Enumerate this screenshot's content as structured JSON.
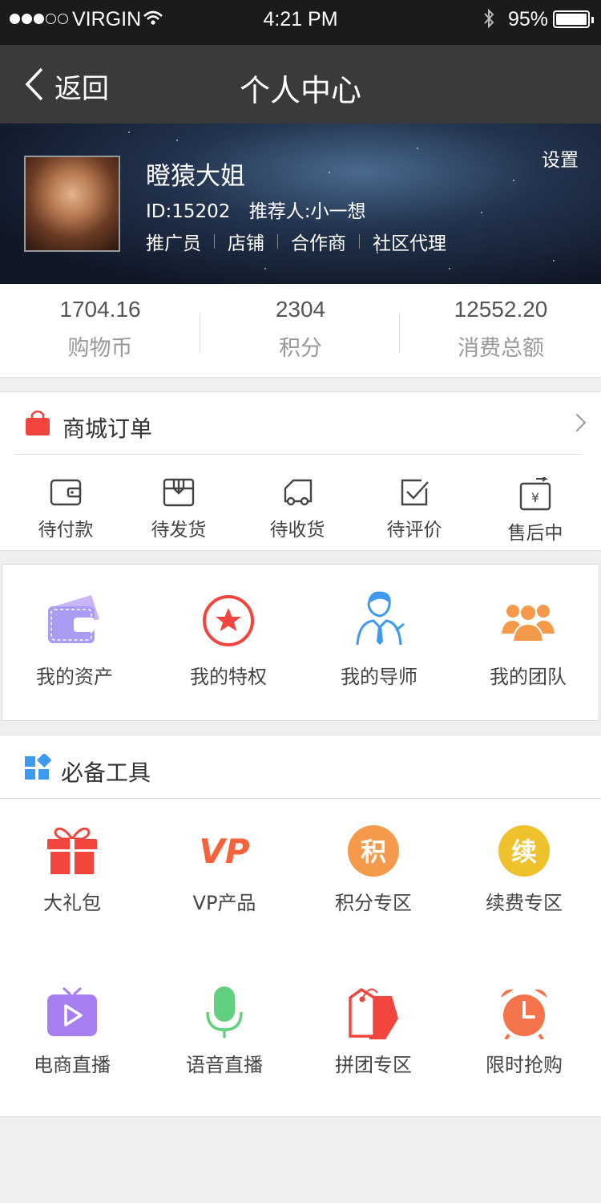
{
  "status_bar": {
    "carrier": "VIRGIN",
    "time": "4:21 PM",
    "battery": "95%"
  },
  "nav": {
    "back_label": "返回",
    "title": "个人中心"
  },
  "profile": {
    "name": "瞪猿大姐",
    "id_text": "ID:15202",
    "referrer_text": "推荐人:小一想",
    "roles": [
      "推广员",
      "店铺",
      "合作商",
      "社区代理"
    ],
    "settings_label": "设置"
  },
  "stats": [
    {
      "value": "1704.16",
      "label": "购物币"
    },
    {
      "value": "2304",
      "label": "积分"
    },
    {
      "value": "12552.20",
      "label": "消费总额"
    }
  ],
  "orders": {
    "title": "商城订单",
    "items": [
      {
        "label": "待付款",
        "icon": "wallet-icon"
      },
      {
        "label": "待发货",
        "icon": "box-icon"
      },
      {
        "label": "待收货",
        "icon": "truck-icon"
      },
      {
        "label": "待评价",
        "icon": "check-icon"
      },
      {
        "label": "售后中",
        "icon": "yen-icon"
      }
    ]
  },
  "assets": {
    "items": [
      {
        "label": "我的资产",
        "icon": "wallet-icon"
      },
      {
        "label": "我的特权",
        "icon": "star-icon"
      },
      {
        "label": "我的导师",
        "icon": "mentor-icon"
      },
      {
        "label": "我的团队",
        "icon": "team-icon"
      }
    ]
  },
  "tools": {
    "title": "必备工具",
    "items": [
      {
        "label": "大礼包",
        "icon": "gift-icon"
      },
      {
        "label": "VP产品",
        "icon": "vp-logo",
        "logo_text": "VP"
      },
      {
        "label": "积分专区",
        "icon": "points-icon",
        "glyph": "积"
      },
      {
        "label": "续费专区",
        "icon": "renew-icon",
        "glyph": "续"
      },
      {
        "label": "电商直播",
        "icon": "tv-play-icon"
      },
      {
        "label": "语音直播",
        "icon": "microphone-icon"
      },
      {
        "label": "拼团专区",
        "icon": "tags-icon"
      },
      {
        "label": "限时抢购",
        "icon": "alarm-clock-icon"
      }
    ]
  },
  "colors": {
    "accent_red": "#f2453d",
    "orange": "#f5994a",
    "yellow": "#eec12d",
    "purple": "#a77ef0",
    "green": "#62d07f",
    "blue": "#3e9af0"
  }
}
